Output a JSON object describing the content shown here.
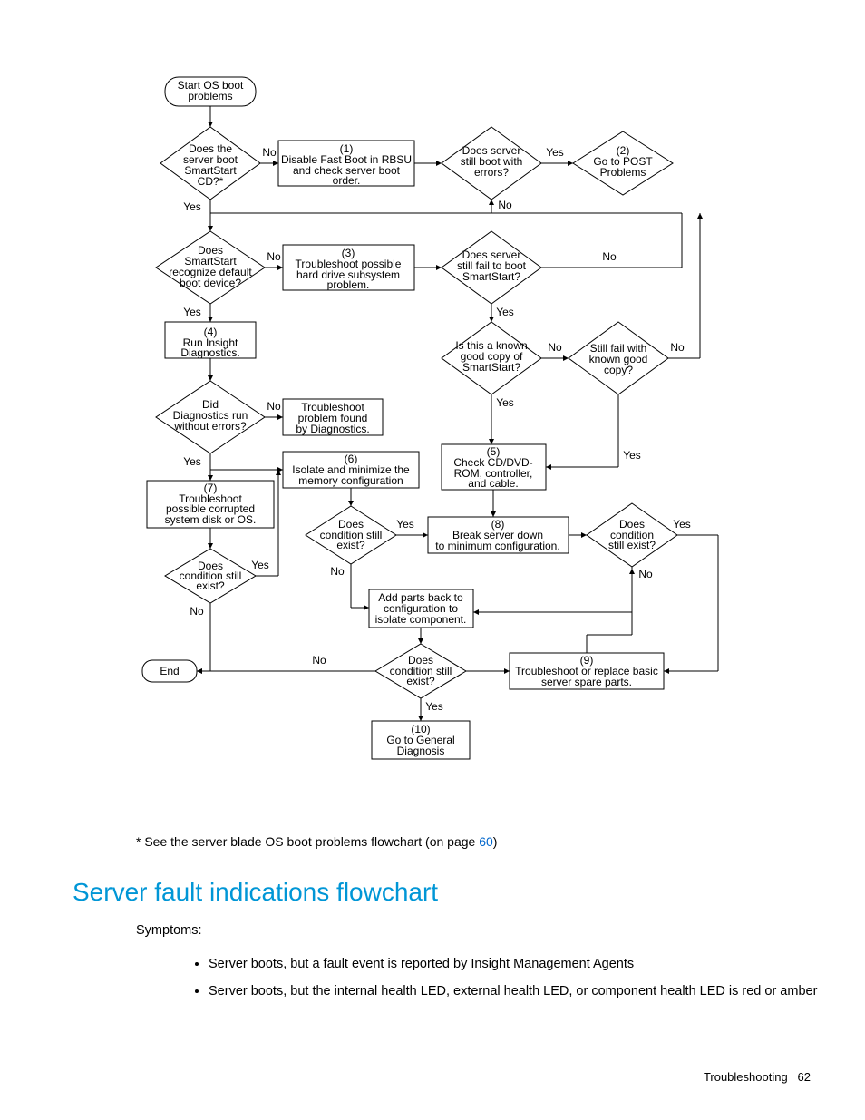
{
  "footnote_prefix": "* See the server blade OS boot problems flowchart (on page ",
  "footnote_link": "60",
  "footnote_suffix": ")",
  "heading": "Server fault indications flowchart",
  "symptoms_label": "Symptoms:",
  "bullet1": "Server boots, but a fault event is reported by Insight Management Agents",
  "bullet2": "Server boots, but the internal health LED, external health LED, or component health LED is red or amber",
  "footer_section": "Troubleshooting",
  "footer_page": "62",
  "chart_data": {
    "type": "flowchart",
    "nodes": [
      {
        "id": "start",
        "type": "terminator",
        "label": "Start OS boot problems"
      },
      {
        "id": "d_bootcd",
        "type": "decision",
        "label": "Does the server boot SmartStart CD?*"
      },
      {
        "id": "p1",
        "type": "process",
        "label": "(1)\nDisable Fast Boot in RBSU and check server boot order."
      },
      {
        "id": "d_stillerrors",
        "type": "decision",
        "label": "Does server still boot with errors?"
      },
      {
        "id": "p2",
        "type": "process",
        "label": "(2)\nGo to POST Problems"
      },
      {
        "id": "d_recognize",
        "type": "decision",
        "label": "Does SmartStart recognize default boot device?"
      },
      {
        "id": "p3",
        "type": "process",
        "label": "(3)\nTroubleshoot possible hard drive subsystem problem."
      },
      {
        "id": "d_failboot",
        "type": "decision",
        "label": "Does server still fail to boot SmartStart?"
      },
      {
        "id": "p4",
        "type": "process",
        "label": "(4)\nRun Insight Diagnostics."
      },
      {
        "id": "d_knowncopy",
        "type": "decision",
        "label": "Is this a known good copy of SmartStart?"
      },
      {
        "id": "d_stillfail",
        "type": "decision",
        "label": "Still fail with known good copy?"
      },
      {
        "id": "d_diagerr",
        "type": "decision",
        "label": "Did Diagnostics run without errors?"
      },
      {
        "id": "p_troubdiag",
        "type": "process",
        "label": "Troubleshoot problem found by Diagnostics."
      },
      {
        "id": "p5",
        "type": "process",
        "label": "(5)\nCheck CD/DVD-ROM, controller, and cable."
      },
      {
        "id": "p6",
        "type": "process",
        "label": "(6)\nIsolate and minimize the memory configuration"
      },
      {
        "id": "p7",
        "type": "process",
        "label": "(7)\nTroubleshoot possible corrupted system disk or OS."
      },
      {
        "id": "d_cond1",
        "type": "decision",
        "label": "Does condition still exist?"
      },
      {
        "id": "p8",
        "type": "process",
        "label": "(8)\nBreak server down to minimum configuration."
      },
      {
        "id": "d_cond_right",
        "type": "decision",
        "label": "Does condition still exist?"
      },
      {
        "id": "d_cond_left",
        "type": "decision",
        "label": "Does condition still exist?"
      },
      {
        "id": "p_addback",
        "type": "process",
        "label": "Add parts back to configuration to isolate component."
      },
      {
        "id": "d_cond2",
        "type": "decision",
        "label": "Does condition still exist?"
      },
      {
        "id": "p9",
        "type": "process",
        "label": "(9)\nTroubleshoot or replace basic server spare parts."
      },
      {
        "id": "end",
        "type": "terminator",
        "label": "End"
      },
      {
        "id": "p10",
        "type": "process",
        "label": "(10)\nGo to General Diagnosis"
      }
    ],
    "edges": [
      {
        "from": "start",
        "to": "d_bootcd"
      },
      {
        "from": "d_bootcd",
        "to": "p1",
        "label": "No"
      },
      {
        "from": "d_bootcd",
        "to": "d_recognize",
        "label": "Yes"
      },
      {
        "from": "p1",
        "to": "d_stillerrors"
      },
      {
        "from": "d_stillerrors",
        "to": "p2",
        "label": "Yes"
      },
      {
        "from": "d_stillerrors",
        "to": "d_failboot",
        "label": "No"
      },
      {
        "from": "d_recognize",
        "to": "p3",
        "label": "No"
      },
      {
        "from": "d_recognize",
        "to": "p4",
        "label": "Yes"
      },
      {
        "from": "p3",
        "to": "d_failboot"
      },
      {
        "from": "d_failboot",
        "to": "d_knowncopy",
        "label": "Yes"
      },
      {
        "from": "d_failboot",
        "to": "d_bootcd",
        "label": "No",
        "note": "loop back"
      },
      {
        "from": "p4",
        "to": "d_diagerr"
      },
      {
        "from": "d_knowncopy",
        "to": "p5",
        "label": "Yes"
      },
      {
        "from": "d_knowncopy",
        "to": "d_stillfail",
        "label": "No"
      },
      {
        "from": "d_stillfail",
        "to": "d_bootcd",
        "label": "No",
        "note": "loop back"
      },
      {
        "from": "d_stillfail",
        "to": "p5",
        "label": "Yes"
      },
      {
        "from": "d_diagerr",
        "to": "p_troubdiag",
        "label": "No"
      },
      {
        "from": "d_diagerr",
        "to": "p7",
        "label": "Yes"
      },
      {
        "from": "d_diagerr",
        "to": "p6",
        "label": "Yes"
      },
      {
        "from": "p6",
        "to": "d_cond1"
      },
      {
        "from": "d_cond1",
        "to": "p8",
        "label": "Yes"
      },
      {
        "from": "d_cond1",
        "to": "p_addback",
        "label": "No"
      },
      {
        "from": "p5",
        "to": "d_cond_right"
      },
      {
        "from": "p8",
        "to": "d_cond_right"
      },
      {
        "from": "d_cond_right",
        "to": "p9",
        "label": "Yes"
      },
      {
        "from": "d_cond_right",
        "to": "p_addback",
        "label": "No"
      },
      {
        "from": "p7",
        "to": "d_cond_left"
      },
      {
        "from": "d_cond_left",
        "to": "p6",
        "label": "Yes"
      },
      {
        "from": "d_cond_left",
        "to": "end",
        "label": "No"
      },
      {
        "from": "p_addback",
        "to": "d_cond2"
      },
      {
        "from": "d_cond2",
        "to": "end",
        "label": "No"
      },
      {
        "from": "d_cond2",
        "to": "p10",
        "label": "Yes"
      },
      {
        "from": "p9",
        "to": "d_cond_right",
        "note": "loop back"
      }
    ]
  }
}
